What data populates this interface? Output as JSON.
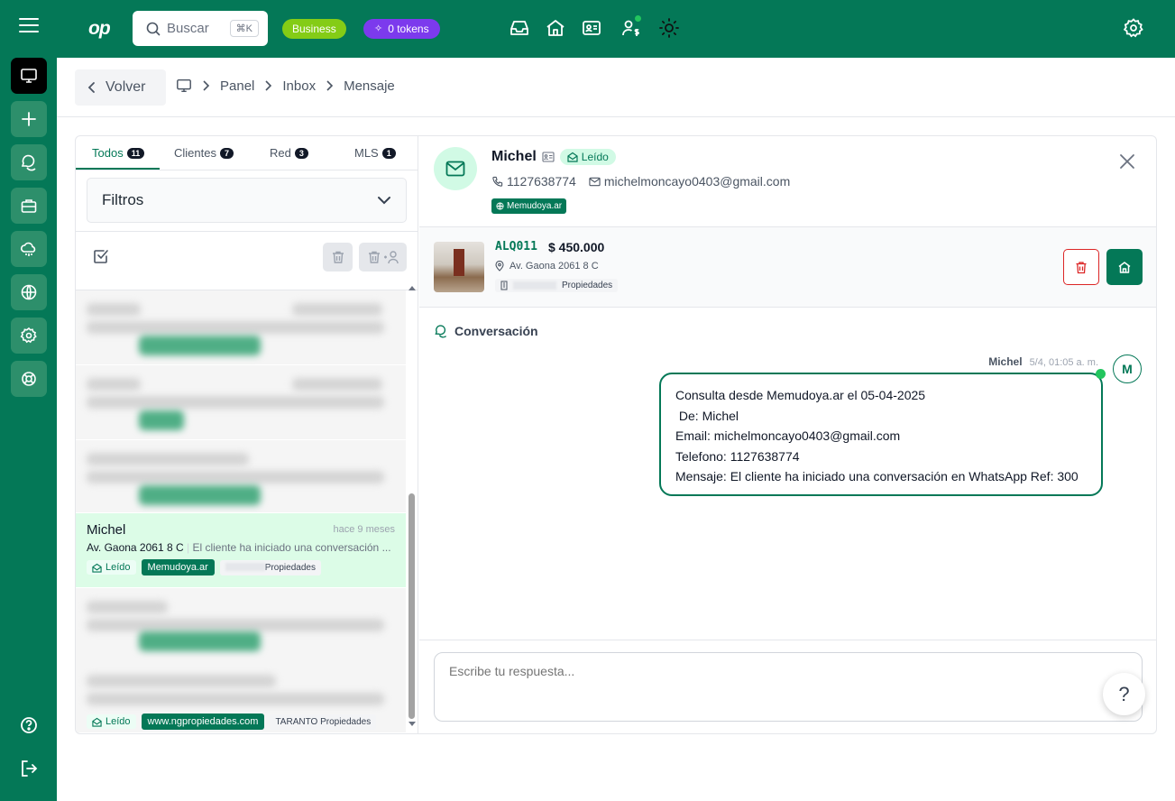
{
  "topbar": {
    "logo": "op",
    "search_placeholder": "Buscar",
    "search_shortcut": "⌘K",
    "plan_badge": "Business",
    "tokens_badge": "0 tokens",
    "icons": [
      "inbox-icon",
      "home-icon",
      "contact-card-icon",
      "user-dollar-icon",
      "sun-icon",
      "settings-icon"
    ],
    "accent": "#047857"
  },
  "sidebar": {
    "items": [
      "desktop-icon",
      "plus-icon",
      "chat-icon",
      "briefcase-icon",
      "cloud-icon",
      "globe-icon",
      "settings-icon",
      "lifebuoy-icon"
    ],
    "bottom": [
      "help-icon",
      "logout-icon"
    ]
  },
  "breadcrumb": {
    "back_label": "Volver",
    "items": [
      "Panel",
      "Inbox",
      "Mensaje"
    ]
  },
  "tabs": [
    {
      "label": "Todos",
      "count": "11"
    },
    {
      "label": "Clientes",
      "count": "7"
    },
    {
      "label": "Red",
      "count": "3"
    },
    {
      "label": "MLS",
      "count": "1"
    }
  ],
  "filters_label": "Filtros",
  "active_item": {
    "name": "Michel",
    "time": "hace 9 meses",
    "address": "Av. Gaona 2061 8 C",
    "snippet": "El cliente ha iniciado una conversación ...",
    "status": "Leído",
    "portal": "Memudoya.ar",
    "agency": "Propiedades"
  },
  "last_item": {
    "status": "Leído",
    "portal": "www.ngpropiedades.com",
    "agency": "TARANTO Propiedades"
  },
  "contact": {
    "name": "Michel",
    "status": "Leído",
    "phone": "1127638774",
    "email": "michelmoncayo0403@gmail.com",
    "portal": "Memudoya.ar"
  },
  "property": {
    "code": "ALQ011",
    "price": "$ 450.000",
    "address": "Av. Gaona 2061 8 C",
    "agency": "Propiedades"
  },
  "conversation": {
    "title": "Conversación",
    "sender": "Michel",
    "timestamp": "5/4, 01:05 a. m.",
    "avatar_initial": "M",
    "lines": [
      "Consulta desde Memudoya.ar el 05-04-2025",
      " De: Michel",
      "Email: michelmoncayo0403@gmail.com",
      "Telefono: 1127638774",
      "Mensaje: El cliente ha iniciado una conversación en WhatsApp Ref: 300"
    ]
  },
  "composer": {
    "placeholder": "Escribe tu respuesta...",
    "help_label": "?"
  }
}
